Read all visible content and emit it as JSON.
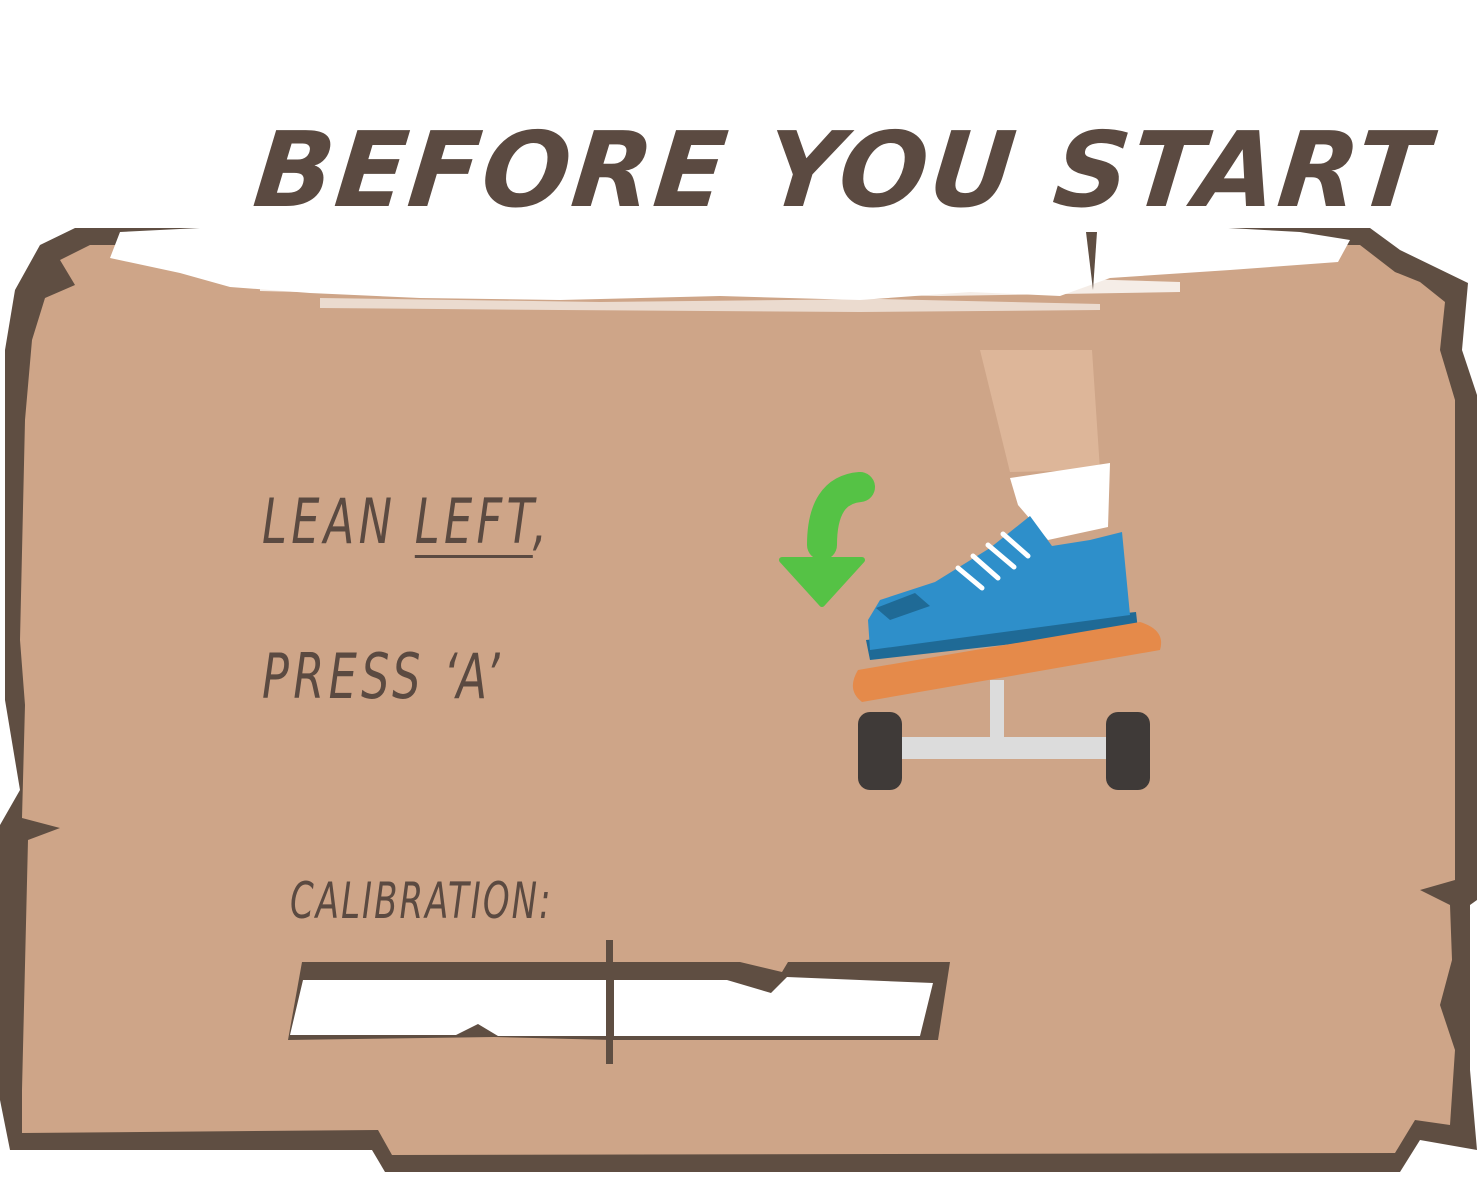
{
  "screen": {
    "title": "Before you start",
    "instruction": {
      "line1_prefix": "LEAN ",
      "line1_emphasis": "LEFT",
      "line1_suffix": ",",
      "line2": "PRESS ‘A’"
    },
    "calibration": {
      "label": "CALIBRATION:",
      "level": 0.5
    },
    "icons": [
      "green-curved-arrow-icon",
      "foot-on-board-icon"
    ],
    "colors": {
      "panel": "#cea588",
      "panel_border": "#5f4e42",
      "text": "#5b4a41",
      "arrow": "#55c245",
      "shoe": "#2e8fca",
      "board": "#e58a4a",
      "wheel": "#3f3a38"
    }
  }
}
